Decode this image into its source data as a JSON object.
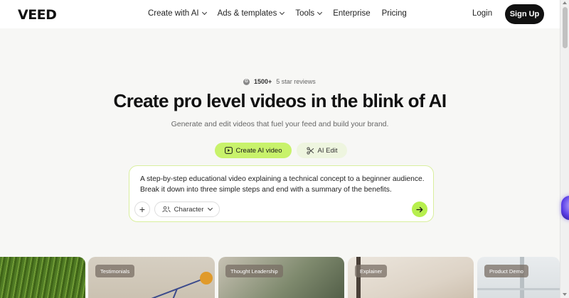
{
  "brand": {
    "logo_text": "VEED",
    "accent": "#c8f26b",
    "dark": "#111111"
  },
  "nav": {
    "items": [
      {
        "label": "Create with AI",
        "dropdown": true
      },
      {
        "label": "Ads & templates",
        "dropdown": true
      },
      {
        "label": "Tools",
        "dropdown": true
      },
      {
        "label": "Enterprise",
        "dropdown": false
      },
      {
        "label": "Pricing",
        "dropdown": false
      }
    ],
    "login": "Login",
    "signup": "Sign Up"
  },
  "hero": {
    "review_count": "1500+",
    "review_label": "5 star reviews",
    "title": "Create pro level videos in the blink of AI",
    "subtitle": "Generate and edit videos that fuel your feed and build your brand.",
    "modes": [
      {
        "label": "Create AI video",
        "icon": "play-icon",
        "active": true
      },
      {
        "label": "AI Edit",
        "icon": "scissors-icon",
        "active": false
      }
    ],
    "prompt_text": "A step-by-step educational video explaining a technical concept to a beginner audience. Break it down into three simple steps and end with a summary of the benefits.",
    "add_icon": "plus-icon",
    "character_label": "Character",
    "send_icon": "arrow-right-icon"
  },
  "cards": [
    {
      "tag": ""
    },
    {
      "tag": "Testimonials"
    },
    {
      "tag": "Thought Leadership"
    },
    {
      "tag": "Explainer"
    },
    {
      "tag": "Product Demo"
    }
  ]
}
